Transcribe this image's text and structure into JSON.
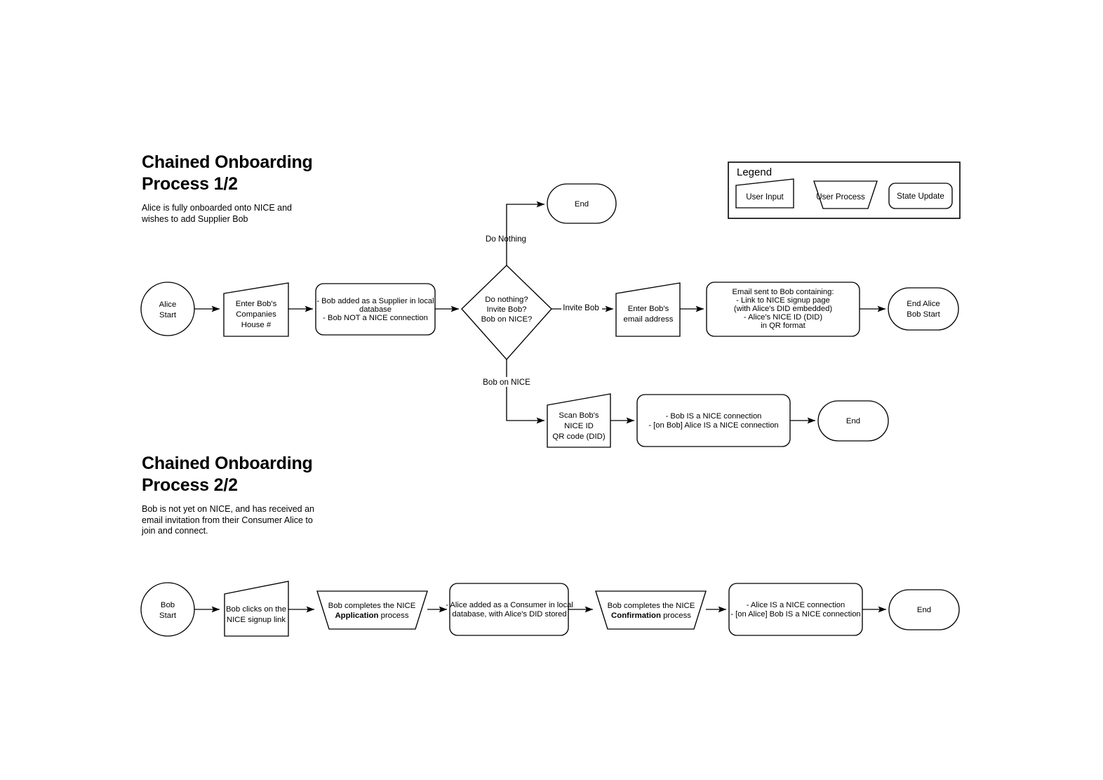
{
  "page": {
    "background": "#ffffff",
    "stroke_color": "#000000"
  },
  "sections": [
    {
      "id": "process-1",
      "title_line1": "Chained Onboarding",
      "title_line2": "Process 1/2",
      "description_line1": "Alice is fully onboarded onto NICE and",
      "description_line2": "wishes to add Supplier Bob",
      "description_line3": ""
    },
    {
      "id": "process-2",
      "title_line1": "Chained Onboarding",
      "title_line2": "Process 2/2",
      "description_line1": "Bob is not yet on NICE, and has received an",
      "description_line2": "email invitation from their Consumer Alice to",
      "description_line3": "join and connect."
    }
  ],
  "legend": {
    "title": "Legend",
    "items": [
      {
        "shape": "user-input",
        "label": "User Input"
      },
      {
        "shape": "user-process",
        "label": "User Process"
      },
      {
        "shape": "state-update",
        "label": "State Update"
      }
    ]
  },
  "flow1": {
    "start": {
      "line1": "Alice",
      "line2": "Start"
    },
    "enter_ch": {
      "line1": "Enter Bob's",
      "line2": "Companies",
      "line3": "House #"
    },
    "supplier_state": {
      "line1": "- Bob added as a Supplier in local",
      "line2": "database",
      "line3": "- Bob NOT a NICE connection"
    },
    "decision": {
      "line1": "Do nothing?",
      "line2": "Invite Bob?",
      "line3": "Bob on NICE?"
    },
    "label_do_nothing": "Do Nothing",
    "label_invite_bob": "Invite Bob",
    "label_bob_on_nice": "Bob on NICE",
    "end_top": "End",
    "enter_email": {
      "line1": "Enter Bob's",
      "line2": "email address"
    },
    "email_state": {
      "line1": "Email sent to Bob containing:",
      "line2": "- Link to NICE signup page",
      "line3": "(with Alice's DID embedded)",
      "line4": "- Alice's NICE ID (DID)",
      "line5": "in QR format"
    },
    "end_alice": {
      "line1": "End Alice",
      "line2": "Bob Start"
    },
    "scan_qr": {
      "line1": "Scan Bob's",
      "line2": "NICE ID",
      "line3": "QR code (DID)"
    },
    "connection_state": {
      "line1": "- Bob IS a NICE connection",
      "line2": "- [on Bob] Alice IS a NICE connection"
    },
    "end_bottom": "End"
  },
  "flow2": {
    "start": {
      "line1": "Bob",
      "line2": "Start"
    },
    "click_link": {
      "line1": "Bob clicks on the",
      "line2": "NICE signup link"
    },
    "application": {
      "line1": "Bob completes the NICE",
      "line2_bold": "Application",
      "line2_rest": " process"
    },
    "consumer_state": {
      "line1": "- Alice added as a Consumer in local",
      "line2": "database, with Alice's DID stored"
    },
    "confirmation": {
      "line1": "Bob completes the NICE",
      "line2_bold": "Confirmation",
      "line2_rest": " process"
    },
    "connection_state": {
      "line1": "- Alice IS a NICE connection",
      "line2": "- [on Alice] Bob IS a NICE connection"
    },
    "end": "End"
  }
}
